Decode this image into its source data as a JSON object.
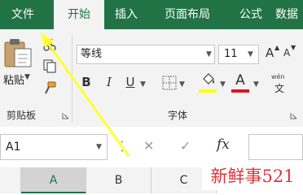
{
  "ribbon": {
    "tabs": {
      "file": "文件",
      "home": "开始",
      "insert": "插入",
      "page_layout": "页面布局",
      "formulas": "公式",
      "data": "数据"
    },
    "clipboard": {
      "paste_label": "粘贴",
      "group_label": "剪贴板"
    },
    "font": {
      "font_name": "等线",
      "font_size": "11",
      "bold": "B",
      "italic": "I",
      "underline": "U",
      "font_color_letter": "A",
      "grow_letter": "A",
      "shrink_letter": "A",
      "phonetic_top": "wén",
      "phonetic_bottom": "文",
      "group_label": "字体",
      "fill_color": "#ffff00",
      "font_color": "#e0141e"
    }
  },
  "formula_bar": {
    "name_box": "A1",
    "fx_label": "fx"
  },
  "grid": {
    "columns": [
      "A",
      "B",
      "C"
    ]
  },
  "watermark": "新鲜事521",
  "annotation": {
    "arrow_color": "#ffff33"
  }
}
